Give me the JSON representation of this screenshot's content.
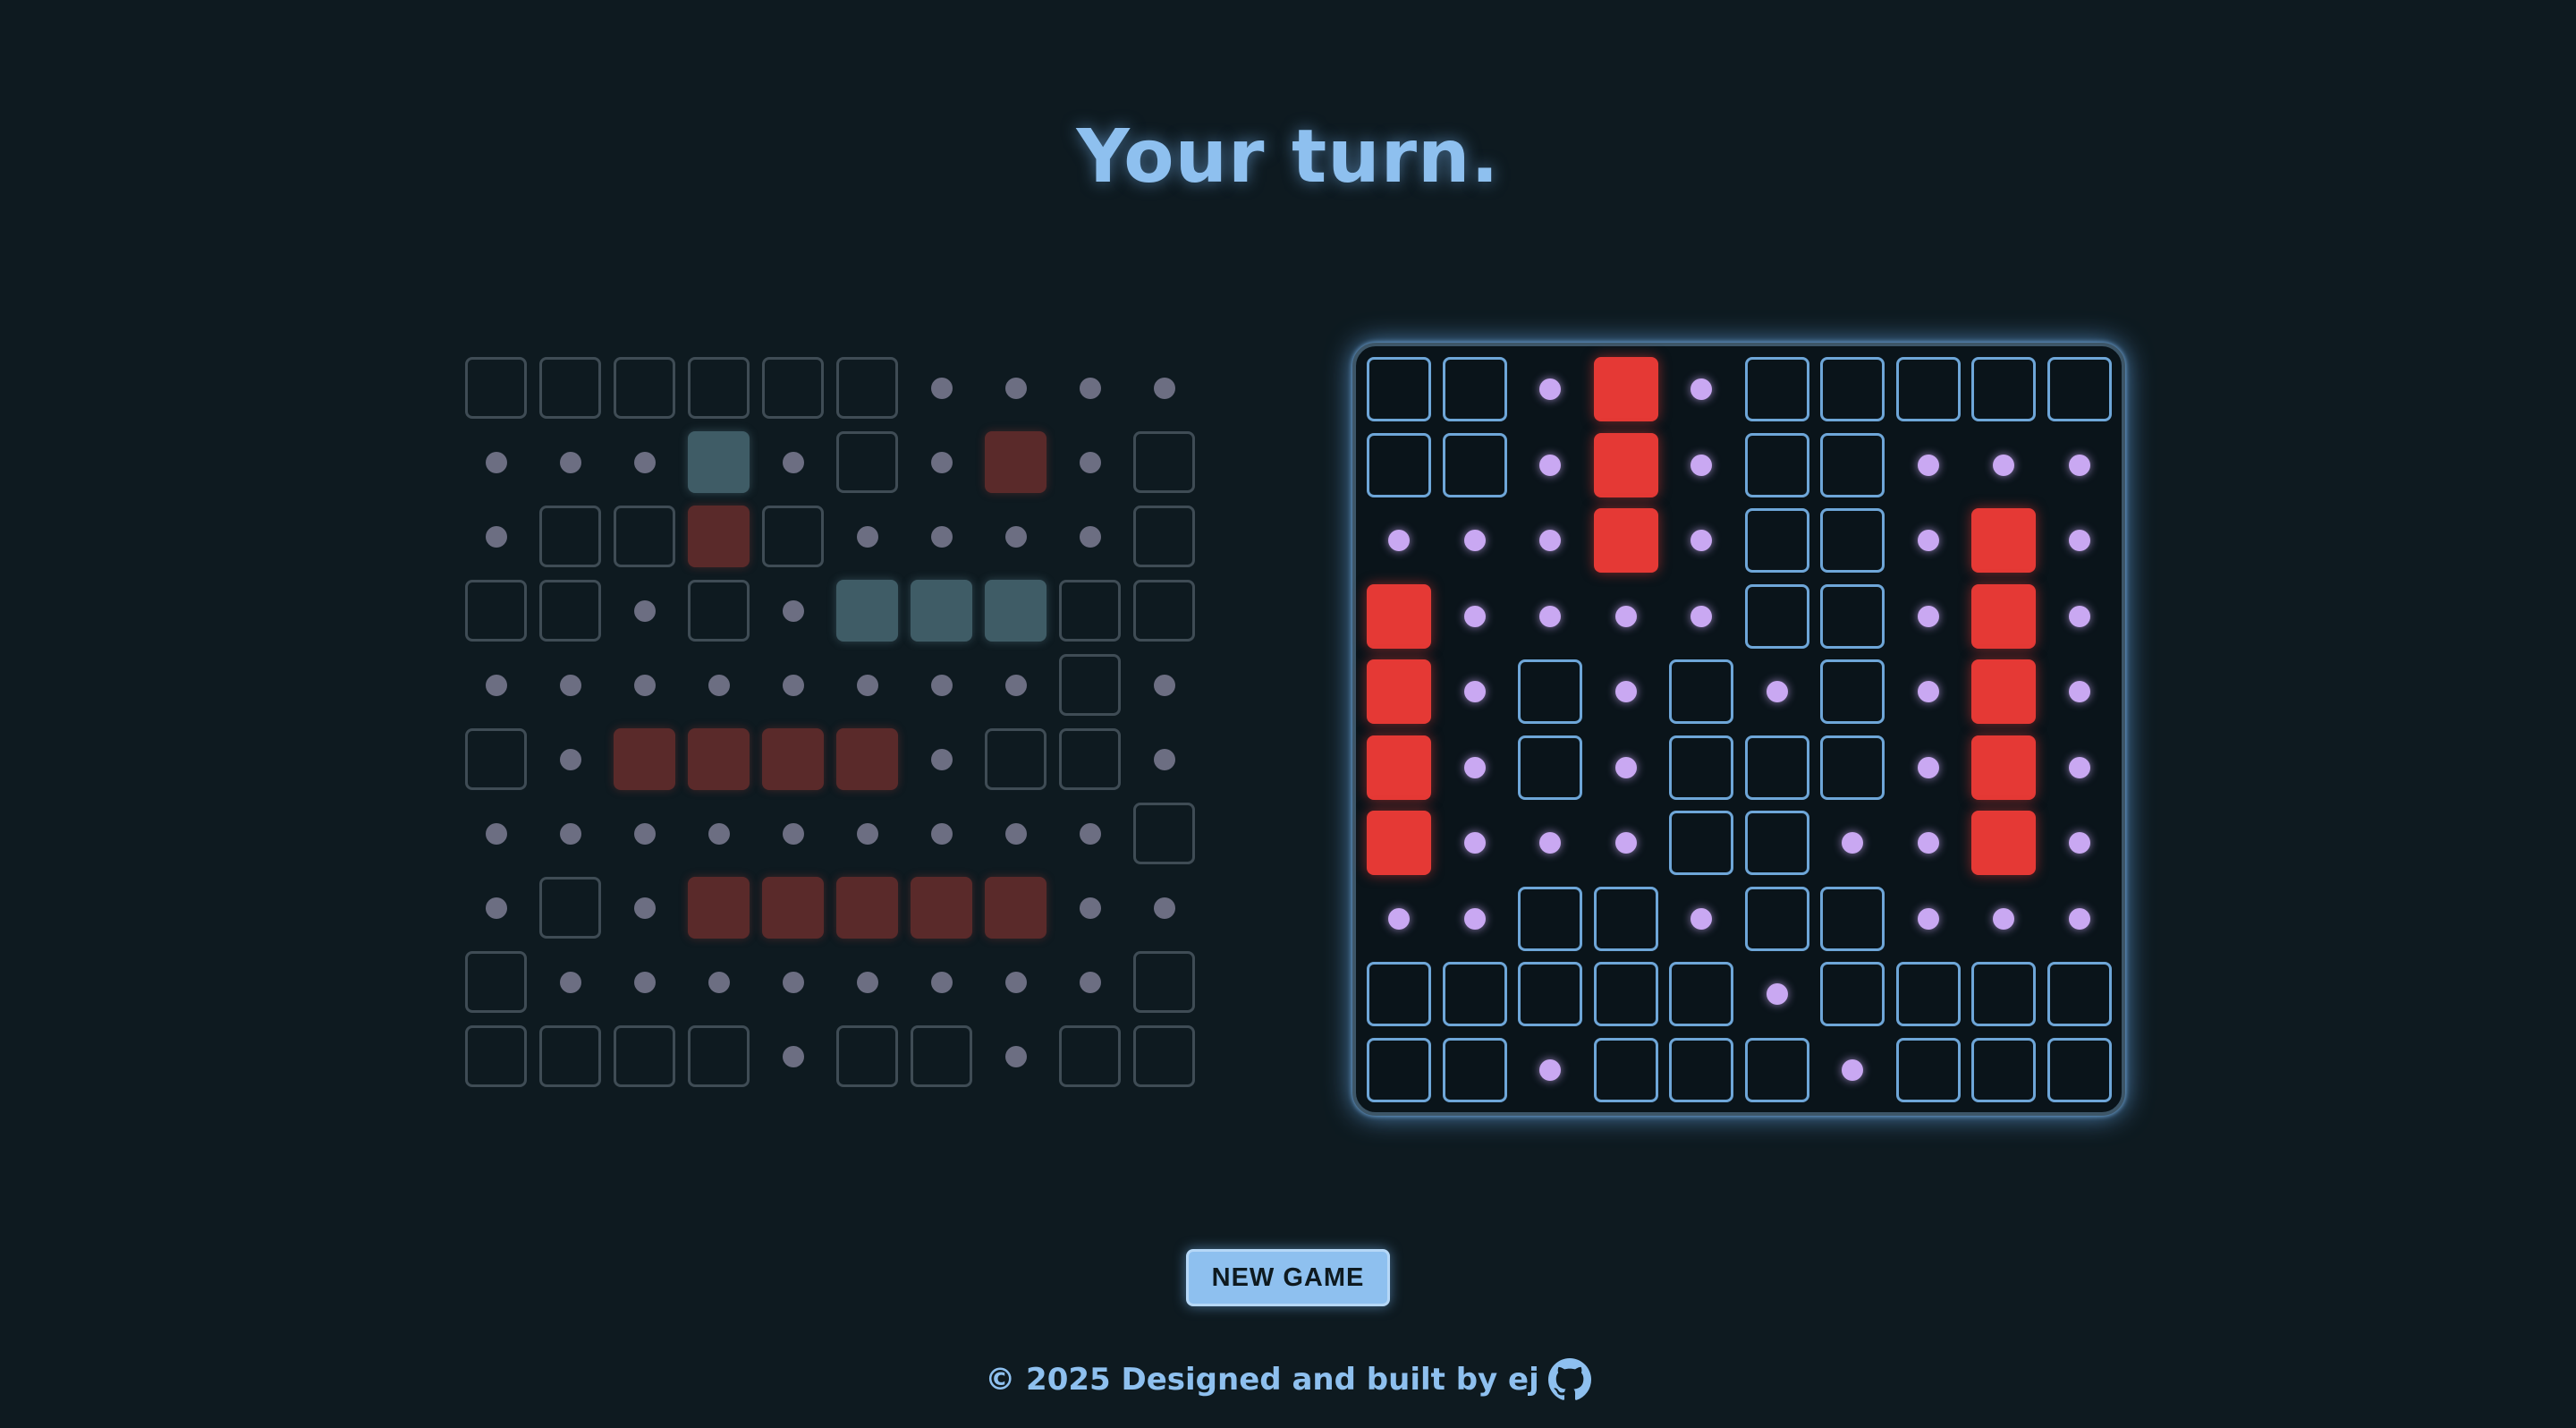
{
  "game": {
    "status": "Your turn.",
    "new_game_label": "NEW GAME",
    "footer_text": "© 2025 Designed and built by ej",
    "footer_icon": "github-icon"
  },
  "colors": {
    "background": "#0e1a20",
    "accent": "#8ec0ef",
    "hit": "#e53935",
    "miss_dot": "#c9a8f2",
    "ship": "#5c7f8c",
    "inactive_border": "#3f4c55"
  },
  "legend": {
    "E": "empty (untargeted)",
    "M": "miss",
    "H": "hit",
    "S": "own ship"
  },
  "own_board": {
    "active": false,
    "rows": [
      "EEEEEEMMMM",
      "MMMSMEMHME",
      "MEEHEMMMME",
      "EEMEMSSSEE",
      "MMMMMMMMEM",
      "EMHHHHMEEM",
      "MMMMMMMMME",
      "MEMHHHHHMM",
      "EMMMMMMMME",
      "EEEEMEEMEE"
    ]
  },
  "target_board": {
    "active": true,
    "rows": [
      "EEMHMEEEEE",
      "EEMHMEEMMM",
      "MMMHMEEMHM",
      "HMMMMEEMHM",
      "HMEMEMEMHM",
      "HMEMEEEMHM",
      "HMMMEEMMHM",
      "MMEEMEEMMM",
      "EEEEEMEEEE",
      "EEMEEEMEEE"
    ]
  }
}
